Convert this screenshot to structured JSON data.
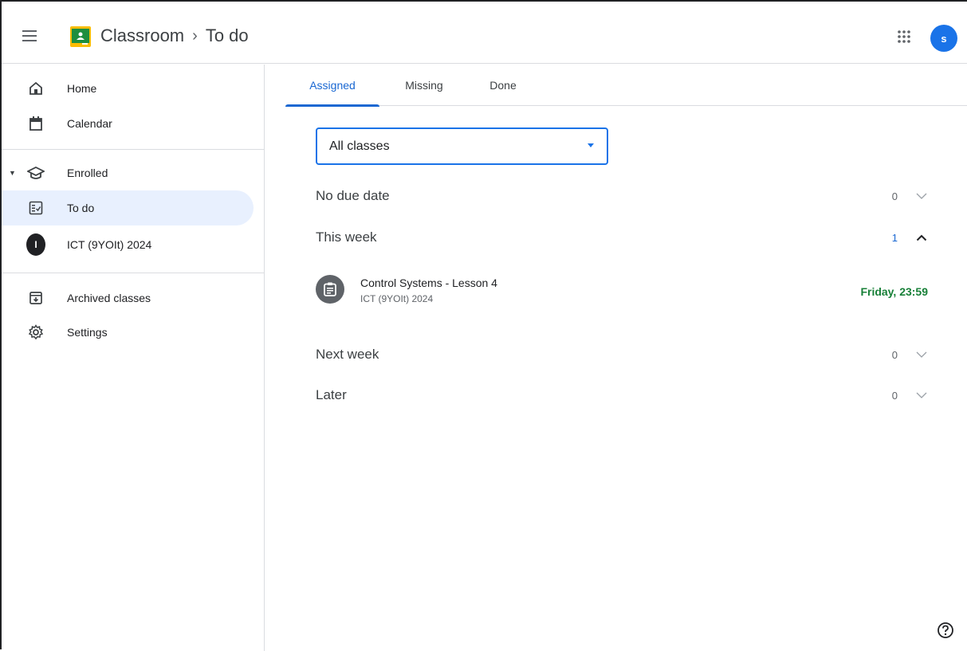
{
  "header": {
    "app_name": "Classroom",
    "separator": "›",
    "current_page": "To do",
    "avatar_letter": "s",
    "colors": {
      "avatar": "#1a73e8",
      "logo_green": "#1e8e3e",
      "logo_yellow": "#fbbc04"
    },
    "icons": {
      "menu": "hamburger-icon",
      "logo": "classroom-logo-icon",
      "apps": "apps-grid-icon"
    }
  },
  "sidebar": {
    "items": [
      {
        "label": "Home",
        "icon": "home-icon"
      },
      {
        "label": "Calendar",
        "icon": "calendar-icon"
      },
      {
        "label": "Enrolled",
        "icon": "graduation-cap-icon"
      },
      {
        "label": "To do",
        "icon": "todo-checklist-icon",
        "active": true
      },
      {
        "label": "ICT (9YOIt) 2024",
        "avatar_letter": "I"
      },
      {
        "label": "Archived classes",
        "icon": "archive-icon"
      },
      {
        "label": "Settings",
        "icon": "gear-icon"
      }
    ]
  },
  "tabs": [
    {
      "label": "Assigned",
      "active": true
    },
    {
      "label": "Missing"
    },
    {
      "label": "Done"
    }
  ],
  "filter": {
    "selected": "All classes"
  },
  "sections": [
    {
      "title": "No due date",
      "count": "0",
      "expanded": false
    },
    {
      "title": "This week",
      "count": "1",
      "expanded": true
    },
    {
      "title": "Next week",
      "count": "0",
      "expanded": false
    },
    {
      "title": "Later",
      "count": "0",
      "expanded": false
    }
  ],
  "task": {
    "title": "Control Systems - Lesson 4",
    "class_name": "ICT (9YOIt) 2024",
    "due": "Friday, 23:59",
    "icon": "assignment-icon",
    "due_color": "#188038"
  },
  "help": {
    "icon": "help-icon"
  }
}
